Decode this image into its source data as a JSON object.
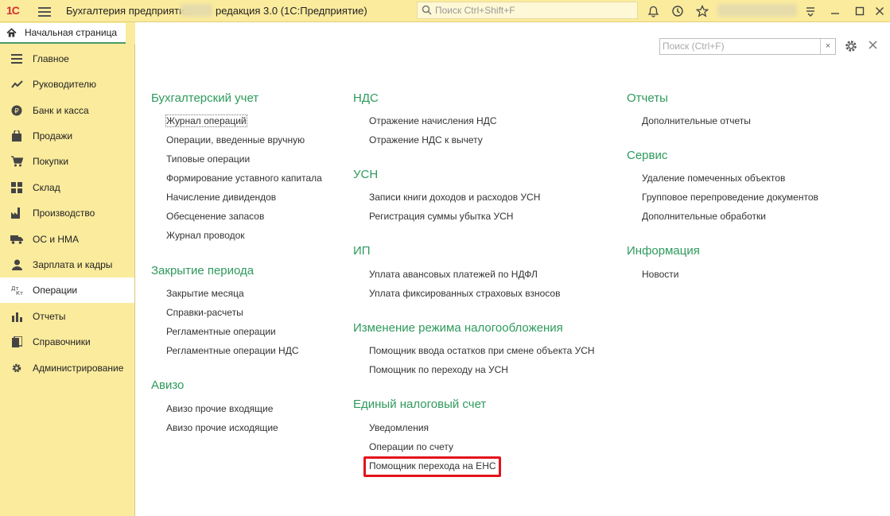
{
  "titlebar": {
    "logo": "1С",
    "title_part1": "Бухгалтерия предприятия",
    "title_part2": "редакция 3.0  (1С:Предприятие)",
    "search_placeholder": "Поиск Ctrl+Shift+F"
  },
  "tab": {
    "label": "Начальная страница"
  },
  "sidebar": {
    "items": [
      {
        "label": "Главное",
        "icon": "menu-icon"
      },
      {
        "label": "Руководителю",
        "icon": "chart-trend-icon"
      },
      {
        "label": "Банк и касса",
        "icon": "coin-icon"
      },
      {
        "label": "Продажи",
        "icon": "bag-icon"
      },
      {
        "label": "Покупки",
        "icon": "cart-icon"
      },
      {
        "label": "Склад",
        "icon": "warehouse-icon"
      },
      {
        "label": "Производство",
        "icon": "factory-icon"
      },
      {
        "label": "ОС и НМА",
        "icon": "truck-icon"
      },
      {
        "label": "Зарплата и кадры",
        "icon": "person-icon"
      },
      {
        "label": "Операции",
        "icon": "dt-kt-icon"
      },
      {
        "label": "Отчеты",
        "icon": "bar-chart-icon"
      },
      {
        "label": "Справочники",
        "icon": "book-icon"
      },
      {
        "label": "Администрирование",
        "icon": "gear-icon"
      }
    ]
  },
  "content": {
    "search_placeholder": "Поиск (Ctrl+F)",
    "col1": {
      "accounting": {
        "title": "Бухгалтерский учет",
        "links": [
          "Журнал операций",
          "Операции, введенные вручную",
          "Типовые операции",
          "Формирование уставного капитала",
          "Начисление дивидендов",
          "Обесценение запасов",
          "Журнал проводок"
        ]
      },
      "period_close": {
        "title": "Закрытие периода",
        "links": [
          "Закрытие месяца",
          "Справки-расчеты",
          "Регламентные операции",
          "Регламентные операции НДС"
        ]
      },
      "aviso": {
        "title": "Авизо",
        "links": [
          "Авизо прочие входящие",
          "Авизо прочие исходящие"
        ]
      }
    },
    "col2": {
      "vat": {
        "title": "НДС",
        "links": [
          "Отражение начисления НДС",
          "Отражение НДС к вычету"
        ]
      },
      "usn": {
        "title": "УСН",
        "links": [
          "Записи книги доходов и расходов УСН",
          "Регистрация суммы убытка УСН"
        ]
      },
      "ip": {
        "title": "ИП",
        "links": [
          "Уплата авансовых платежей по НДФЛ",
          "Уплата фиксированных страховых взносов"
        ]
      },
      "tax_change": {
        "title": "Изменение режима налогообложения",
        "links": [
          "Помощник ввода остатков при смене объекта УСН",
          "Помощник по переходу на УСН"
        ]
      },
      "ens": {
        "title": "Единый налоговый счет",
        "links": [
          "Уведомления",
          "Операции по счету",
          "Помощник перехода на ЕНС"
        ]
      }
    },
    "col3": {
      "reports": {
        "title": "Отчеты",
        "links": [
          "Дополнительные отчеты"
        ]
      },
      "service": {
        "title": "Сервис",
        "links": [
          "Удаление помеченных объектов",
          "Групповое перепроведение документов",
          "Дополнительные обработки"
        ]
      },
      "info": {
        "title": "Информация",
        "links": [
          "Новости"
        ]
      }
    }
  },
  "colors": {
    "section_title": "#2e9a5c",
    "sidebar_bg": "#fbeb9d",
    "highlight": "#e4131d"
  }
}
